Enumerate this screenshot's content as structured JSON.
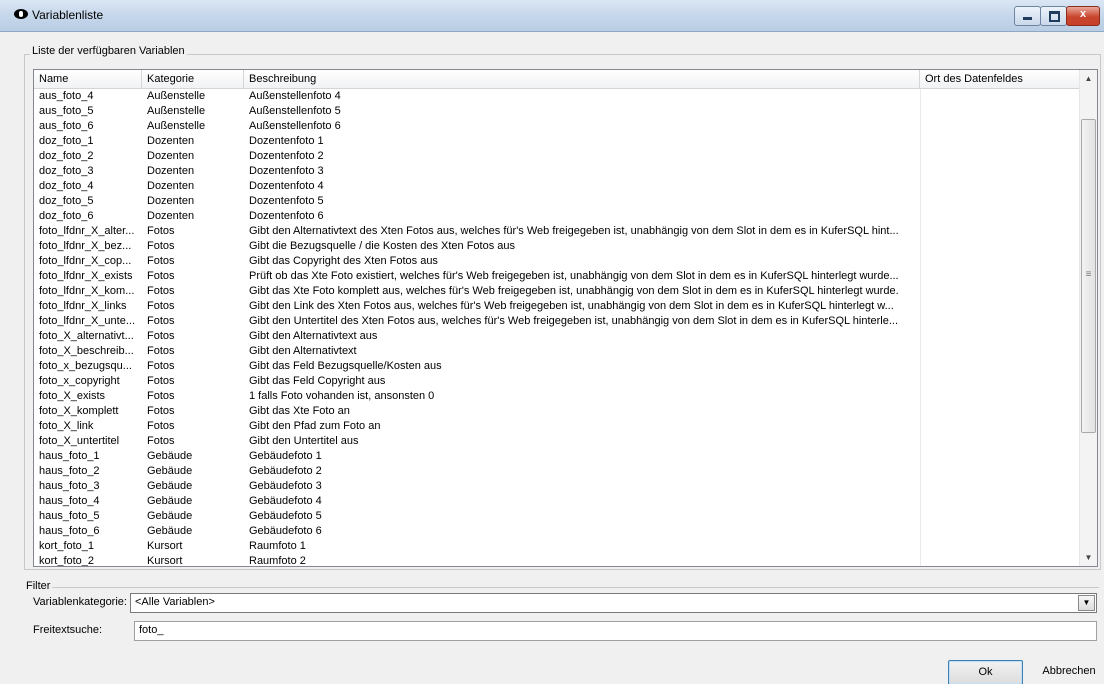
{
  "window": {
    "title": "Variablenliste",
    "controls": {
      "minimize": "–",
      "maximize": "□",
      "close": "x"
    }
  },
  "list_group": {
    "label": "Liste der verfügbaren Variablen"
  },
  "table": {
    "columns": [
      "Name",
      "Kategorie",
      "Beschreibung",
      "Ort des Datenfeldes"
    ],
    "rows": [
      [
        "aus_foto_4",
        "Außenstelle",
        "Außenstellenfoto 4",
        ""
      ],
      [
        "aus_foto_5",
        "Außenstelle",
        "Außenstellenfoto 5",
        ""
      ],
      [
        "aus_foto_6",
        "Außenstelle",
        "Außenstellenfoto 6",
        ""
      ],
      [
        "doz_foto_1",
        "Dozenten",
        "Dozentenfoto 1",
        ""
      ],
      [
        "doz_foto_2",
        "Dozenten",
        "Dozentenfoto 2",
        ""
      ],
      [
        "doz_foto_3",
        "Dozenten",
        "Dozentenfoto 3",
        ""
      ],
      [
        "doz_foto_4",
        "Dozenten",
        "Dozentenfoto 4",
        ""
      ],
      [
        "doz_foto_5",
        "Dozenten",
        "Dozentenfoto 5",
        ""
      ],
      [
        "doz_foto_6",
        "Dozenten",
        "Dozentenfoto 6",
        ""
      ],
      [
        "foto_lfdnr_X_alter...",
        "Fotos",
        "Gibt den Alternativtext des Xten Fotos aus, welches für's Web freigegeben ist, unabhängig von dem Slot in dem es in KuferSQL hint...",
        ""
      ],
      [
        "foto_lfdnr_X_bez...",
        "Fotos",
        "Gibt die Bezugsquelle / die Kosten des Xten Fotos  aus",
        ""
      ],
      [
        "foto_lfdnr_X_cop...",
        "Fotos",
        "Gibt das Copyright des Xten Fotos aus",
        ""
      ],
      [
        "foto_lfdnr_X_exists",
        "Fotos",
        "Prüft ob das Xte Foto existiert, welches für's Web freigegeben ist, unabhängig von dem Slot in dem es in KuferSQL hinterlegt wurde...",
        ""
      ],
      [
        "foto_lfdnr_X_kom...",
        "Fotos",
        "Gibt das Xte Foto komplett aus, welches für's Web freigegeben ist, unabhängig von dem Slot in dem es in KuferSQL hinterlegt wurde.",
        ""
      ],
      [
        "foto_lfdnr_X_links",
        "Fotos",
        "Gibt den Link des Xten Fotos aus, welches für's Web freigegeben ist, unabhängig von dem Slot in dem es in KuferSQL hinterlegt w...",
        ""
      ],
      [
        "foto_lfdnr_X_unte...",
        "Fotos",
        "Gibt den Untertitel des Xten Fotos aus, welches für's Web freigegeben ist, unabhängig von dem Slot in dem es in KuferSQL hinterle...",
        ""
      ],
      [
        "foto_X_alternativt...",
        "Fotos",
        "Gibt den Alternativtext aus",
        ""
      ],
      [
        "foto_X_beschreib...",
        "Fotos",
        "Gibt den Alternativtext",
        ""
      ],
      [
        "foto_x_bezugsqu...",
        "Fotos",
        "Gibt das Feld Bezugsquelle/Kosten aus",
        ""
      ],
      [
        "foto_x_copyright",
        "Fotos",
        "Gibt das Feld Copyright aus",
        ""
      ],
      [
        "foto_X_exists",
        "Fotos",
        "1 falls Foto vohanden ist, ansonsten 0",
        ""
      ],
      [
        "foto_X_komplett",
        "Fotos",
        "Gibt das Xte Foto an",
        ""
      ],
      [
        "foto_X_link",
        "Fotos",
        "Gibt den Pfad zum Foto an",
        ""
      ],
      [
        "foto_X_untertitel",
        "Fotos",
        "Gibt den Untertitel aus",
        ""
      ],
      [
        "haus_foto_1",
        "Gebäude",
        "Gebäudefoto 1",
        ""
      ],
      [
        "haus_foto_2",
        "Gebäude",
        "Gebäudefoto 2",
        ""
      ],
      [
        "haus_foto_3",
        "Gebäude",
        "Gebäudefoto 3",
        ""
      ],
      [
        "haus_foto_4",
        "Gebäude",
        "Gebäudefoto 4",
        ""
      ],
      [
        "haus_foto_5",
        "Gebäude",
        "Gebäudefoto 5",
        ""
      ],
      [
        "haus_foto_6",
        "Gebäude",
        "Gebäudefoto 6",
        ""
      ],
      [
        "kort_foto_1",
        "Kursort",
        "Raumfoto 1",
        ""
      ],
      [
        "kort_foto_2",
        "Kursort",
        "Raumfoto 2",
        ""
      ]
    ]
  },
  "scrollbar": {
    "up_icon": "▲",
    "down_icon": "▼",
    "grip_icon": "≡"
  },
  "filter": {
    "label": "Filter",
    "category_label": "Variablenkategorie:",
    "category_value": "<Alle Variablen>",
    "dropdown_icon": "▼",
    "search_label": "Freitextsuche:",
    "search_value": "foto_"
  },
  "buttons": {
    "ok": "Ok",
    "cancel": "Abbrechen"
  }
}
